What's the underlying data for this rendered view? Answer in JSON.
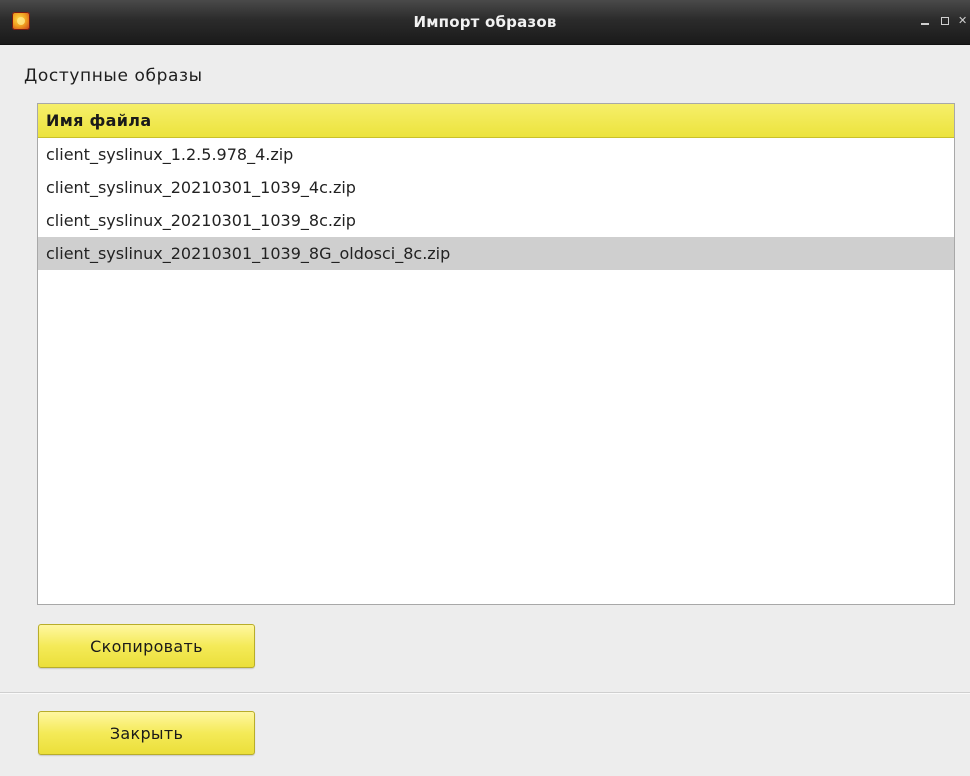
{
  "window": {
    "title": "Импорт образов",
    "controls": {
      "minimize": "",
      "maximize": "",
      "close": "✕"
    }
  },
  "section": {
    "heading": "Доступные образы"
  },
  "file_list": {
    "column_header": "Имя файла",
    "items": [
      {
        "name": "client_syslinux_1.2.5.978_4.zip",
        "selected": false
      },
      {
        "name": "client_syslinux_20210301_1039_4c.zip",
        "selected": false
      },
      {
        "name": "client_syslinux_20210301_1039_8c.zip",
        "selected": false
      },
      {
        "name": "client_syslinux_20210301_1039_8G_oldosci_8c.zip",
        "selected": true
      }
    ]
  },
  "buttons": {
    "copy_label": "Скопировать",
    "close_label": "Закрыть"
  },
  "colors": {
    "accent_yellow": "#f4ea58",
    "titlebar": "#2b2b2b",
    "selection": "#cfcfcf"
  }
}
